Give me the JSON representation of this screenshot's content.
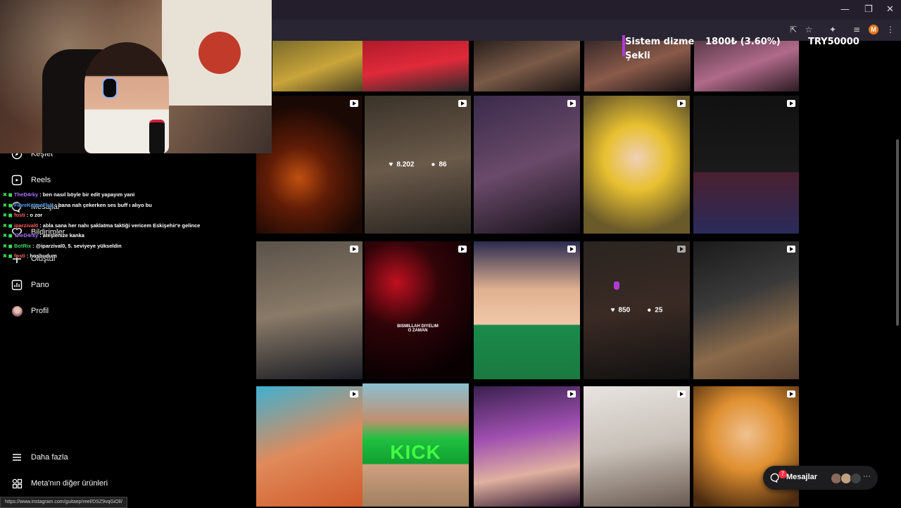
{
  "browser": {
    "window_controls": {
      "minimize": "—",
      "maximize": "❐",
      "close": "✕"
    },
    "avatar_letter": "M",
    "status_url": "https://www.instagram.com/guitaep/reel/DSZ9vqGiOll/"
  },
  "stock_overlay": {
    "name": "Sistem dizme\nŞekli",
    "value": "1800₺ (3.60%)",
    "total": "TRY50000"
  },
  "sidebar": {
    "items": [
      {
        "label": "Keşfet",
        "icon": "compass-icon"
      },
      {
        "label": "Reels",
        "icon": "reels-icon"
      },
      {
        "label": "Mesajlar",
        "icon": "messenger-icon"
      },
      {
        "label": "Bildirimler",
        "icon": "heart-icon"
      },
      {
        "label": "Oluştur",
        "icon": "plus-icon"
      },
      {
        "label": "Pano",
        "icon": "dashboard-icon"
      },
      {
        "label": "Profil",
        "icon": "profile-avatar"
      }
    ],
    "bottom": [
      {
        "label": "Daha fazla",
        "icon": "menu-icon"
      },
      {
        "label": "Meta'nın diğer ürünleri",
        "icon": "apps-icon"
      }
    ]
  },
  "chat": [
    {
      "user": "TheD4rky",
      "color": "#a970ff",
      "text": ": ben nasıl böyle bir edit yapayım yani"
    },
    {
      "user": "FibreKelmeFlux",
      "color": "#4aa3ff",
      "text": ": bana nah çekerken ses buff ı alıyo bu"
    },
    {
      "user": "fosti",
      "color": "#ff5c5c",
      "text": ": o zor"
    },
    {
      "user": "iparzival0",
      "color": "#ff5c5c",
      "text": ": abla sana her nahı şaklatma taktiği vericem Eskişehir'e gelince"
    },
    {
      "user": "TheD4rky",
      "color": "#a970ff",
      "text": ": ateşlenize kanka"
    },
    {
      "user": "BotRix",
      "color": "#3ddc5a",
      "text": ": @iparzival0, 5. seviyeye yükseldin"
    },
    {
      "user": "fosti",
      "color": "#ff5c5c",
      "text": ": hoşbudum"
    }
  ],
  "grid": {
    "stats": [
      {
        "likes": "8.202",
        "comments": "86"
      },
      {
        "likes": "850",
        "comments": "25"
      }
    ],
    "kick_text": "KICK",
    "bismillah_text": "BISMILLAH DIYELIM\nO ZAMAN"
  },
  "messages_pill": {
    "label": "Mesajlar",
    "count": "7",
    "more": "···"
  }
}
